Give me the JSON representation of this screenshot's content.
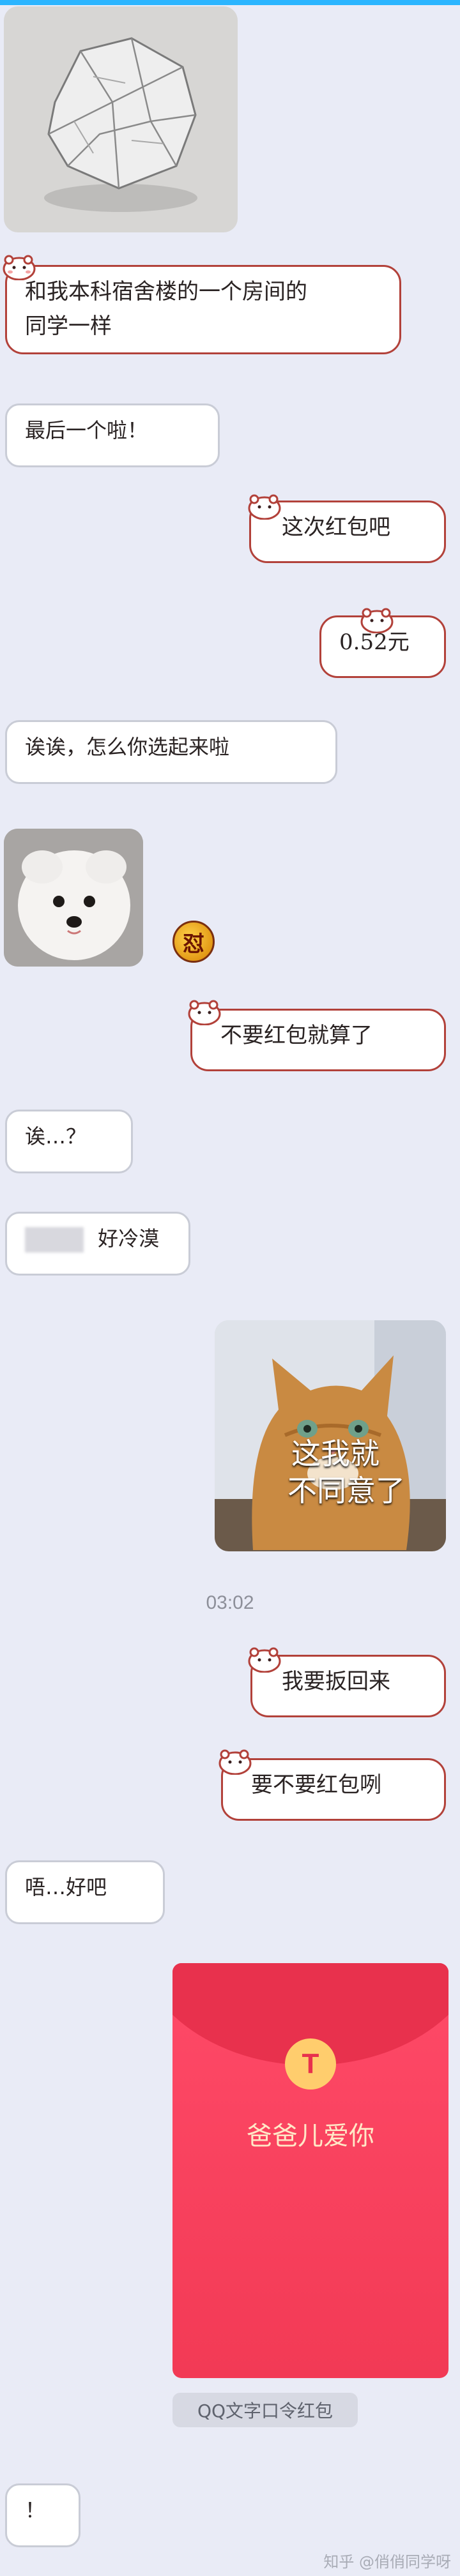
{
  "chat": {
    "msg1": {
      "line1": "和我本科宿舍楼的一个房间的",
      "line2": "同学一样"
    },
    "msg2": "最后一个啦！",
    "msg3": "这次红包吧",
    "msg4": "0.52元",
    "msg5": "诶诶，怎么你选起来啦",
    "angry_badge": "怼",
    "msg6": "不要红包就算了",
    "msg7": "诶…？",
    "msg8": "好冷漠",
    "sticker_cat_text": {
      "line1": "这我就",
      "line2": "不同意了"
    },
    "timestamp": "03:02",
    "msg9": "我要扳回来",
    "msg10": "要不要红包咧",
    "msg11": "唔…好吧",
    "red_packet": {
      "icon_char": "T",
      "title": "爸爸儿爱你",
      "label": "QQ文字口令红包"
    },
    "msg12": "！"
  },
  "watermark": "知乎 @俏俏同学呀",
  "colors": {
    "accent_border": "#b2413a",
    "top_bar": "#2bb5ff",
    "red_packet": "#f23a55"
  }
}
